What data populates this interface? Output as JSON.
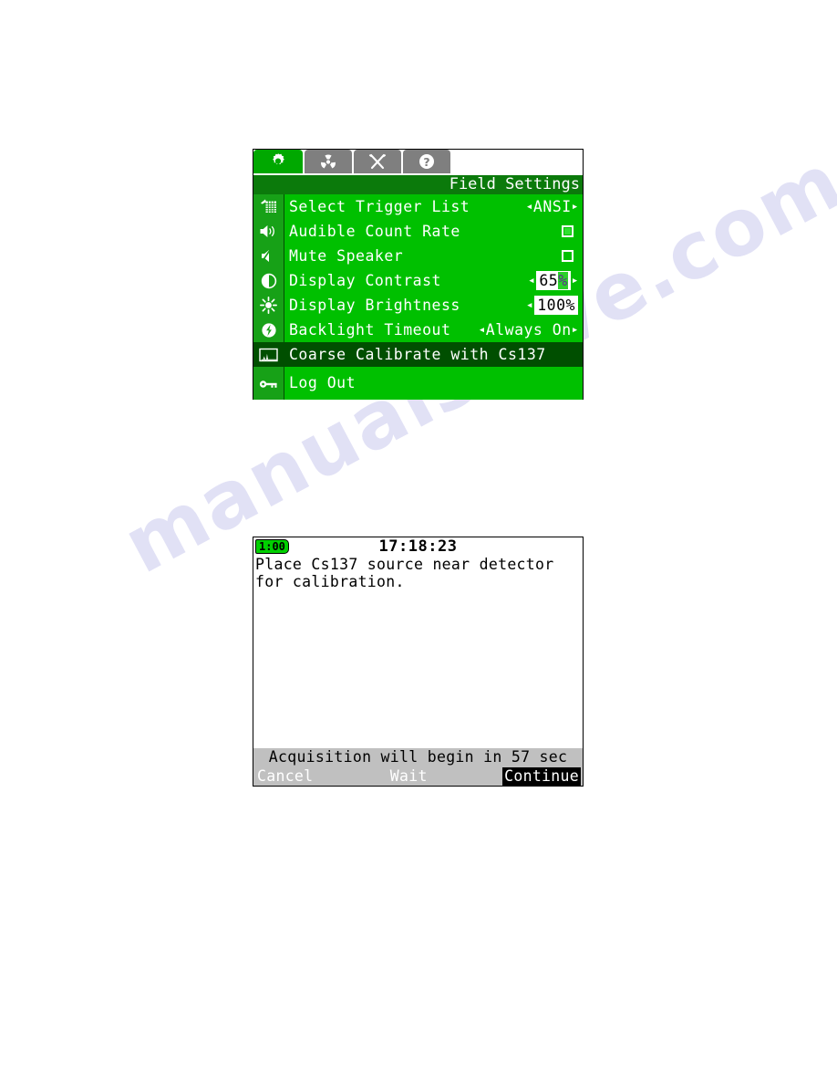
{
  "settings_screen": {
    "tabs": [
      {
        "name": "tab-settings",
        "icon": "gear-icon",
        "active": true
      },
      {
        "name": "tab-radiation",
        "icon": "trefoil-icon",
        "active": false
      },
      {
        "name": "tab-tools",
        "icon": "crossed-tools-icon",
        "active": false
      },
      {
        "name": "tab-help",
        "icon": "question-mark-icon",
        "active": false
      }
    ],
    "title": "Field Settings",
    "rows": [
      {
        "icon": "trigger-list-icon",
        "label": "Select Trigger List",
        "value_type": "spinner",
        "arrow_left": "◂",
        "arrow_right": "▸",
        "value": "ANSI",
        "selected": false
      },
      {
        "icon": "speaker-on-icon",
        "label": "Audible Count Rate",
        "value_type": "checkbox",
        "checked": true,
        "selected": false
      },
      {
        "icon": "speaker-mute-icon",
        "label": "Mute Speaker",
        "value_type": "checkbox",
        "checked": false,
        "selected": false
      },
      {
        "icon": "contrast-icon",
        "label": "Display Contrast",
        "value_type": "editbox",
        "arrow_left": "◂",
        "arrow_right": "▸",
        "value": "65",
        "value_cursor": "%",
        "selected": false
      },
      {
        "icon": "brightness-icon",
        "label": "Display Brightness",
        "value_type": "editbox",
        "arrow_left": "◂",
        "arrow_right": "",
        "value": "100%",
        "value_cursor": "",
        "selected": false
      },
      {
        "icon": "backlight-icon",
        "label": "Backlight Timeout",
        "value_type": "spinner",
        "arrow_left": "◂",
        "arrow_right": "▸",
        "value": "Always On",
        "selected": false
      },
      {
        "icon": "spectrum-icon",
        "label": "Coarse Calibrate with Cs137",
        "value_type": "none",
        "selected": true
      },
      {
        "icon": "key-icon",
        "label": "Log Out",
        "value_type": "none",
        "selected": false
      }
    ]
  },
  "calibration_screen": {
    "timer": "1:00",
    "clock": "17:18:23",
    "message_line_1": "Place Cs137 source near detector",
    "message_line_2": "for calibration.",
    "status": "Acquisition will begin in 57 sec",
    "buttons": [
      {
        "name": "cancel-button",
        "label": "Cancel",
        "highlight": false
      },
      {
        "name": "wait-button",
        "label": "Wait",
        "highlight": false
      },
      {
        "name": "continue-button",
        "label": "Continue",
        "highlight": true
      }
    ]
  },
  "watermark": {
    "text": "manualshive.com"
  },
  "colors": {
    "screen_green": "#00c000",
    "icon_column_green": "#17a117",
    "title_green": "#0b7a0b",
    "selected_row_green": "#004f00",
    "tab_inactive_gray": "#7f7f7f",
    "status_bar_gray": "#c0c0c0",
    "text_white": "#ffffff",
    "text_black": "#000000",
    "timer_chip_green": "#00d000",
    "cursor_green": "#2ad02a",
    "cursor_purple": "#5b2f8f"
  }
}
